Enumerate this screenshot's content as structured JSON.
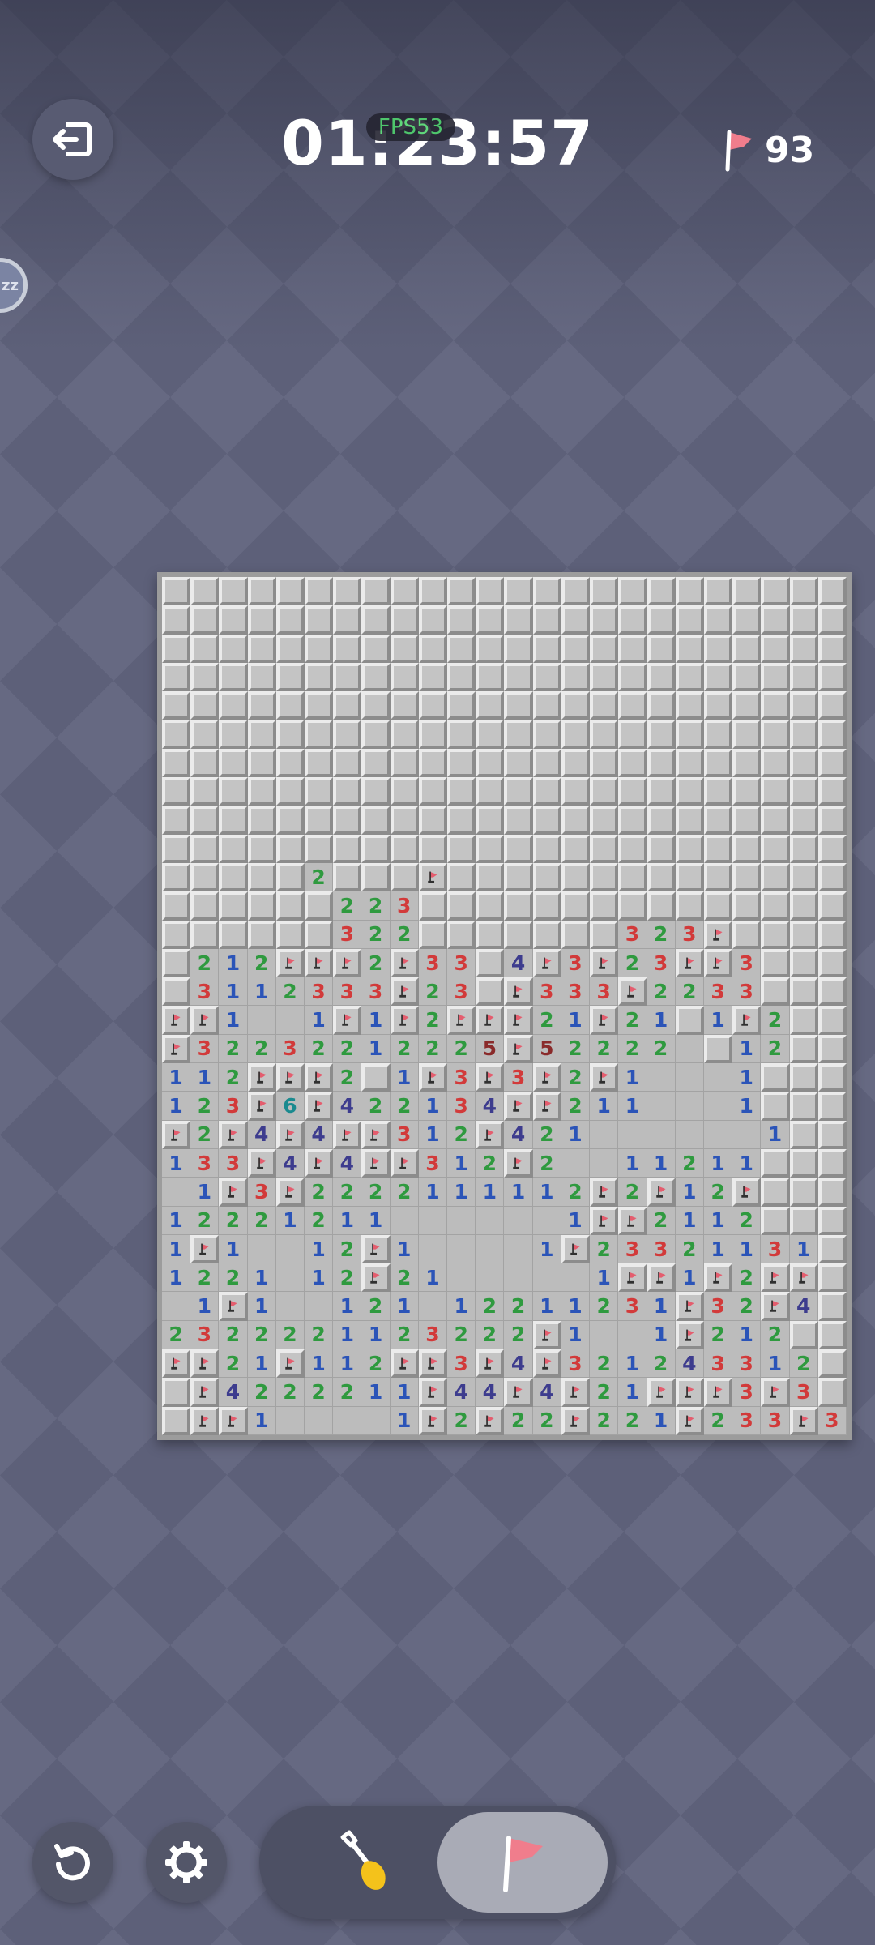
{
  "header": {
    "timer": "01:23:57",
    "fps_label": "FPS53",
    "flags_remaining": "93",
    "exit_icon": "exit-icon",
    "sleep_label": "zz"
  },
  "board": {
    "columns": 24,
    "rows": 30,
    "legend": ". = unrevealed, 0 = revealed empty, 1-8 = number, F = flag",
    "grid": [
      "........................",
      "........................",
      "........................",
      "........................",
      "........................",
      "........................",
      "........................",
      "........................",
      "........................",
      "........................",
      ".....2...F..............",
      "......223...............",
      "......322.......323F....",
      ".212FFF2F33.4F3F23FF3...",
      ".3112333F23.F333F2233...",
      "FF1001F1F2FFF21F21.1F2..",
      "F32232212225F522220.12..",
      "112FFF2.1F3F3F2F10001...",
      "123F6F422134FF2110001...",
      "F2F4F4FF312F4210000001..",
      "133F4F4FF312F20011211...",
      "01F3F2222111112F2F12F...",
      "122212110000001FF2112...",
      "1F10012F100001F23321131.",
      "1221012F21000001FF1F2FF.",
      "01F100121012211231F32F4.",
      "2322221123222F1001F212..",
      "FF21F112FF3F4F321243312.",
      ".F4222211F44F4F21FFF3F3.",
      ".FF100001F2F22F221F233F3"
    ]
  },
  "controls": {
    "reset_icon": "reset-icon",
    "settings_icon": "gear-icon",
    "dig_icon": "shovel-icon",
    "flag_icon": "flag-icon",
    "selected_mode": "flag"
  },
  "colors": {
    "n1": "#2b54b8",
    "n2": "#2f9a3f",
    "n3": "#d23a3a",
    "n4": "#3d3c8e",
    "n5": "#8a2a2a",
    "n6": "#1a8a8f",
    "flag": "#e45d6e"
  }
}
